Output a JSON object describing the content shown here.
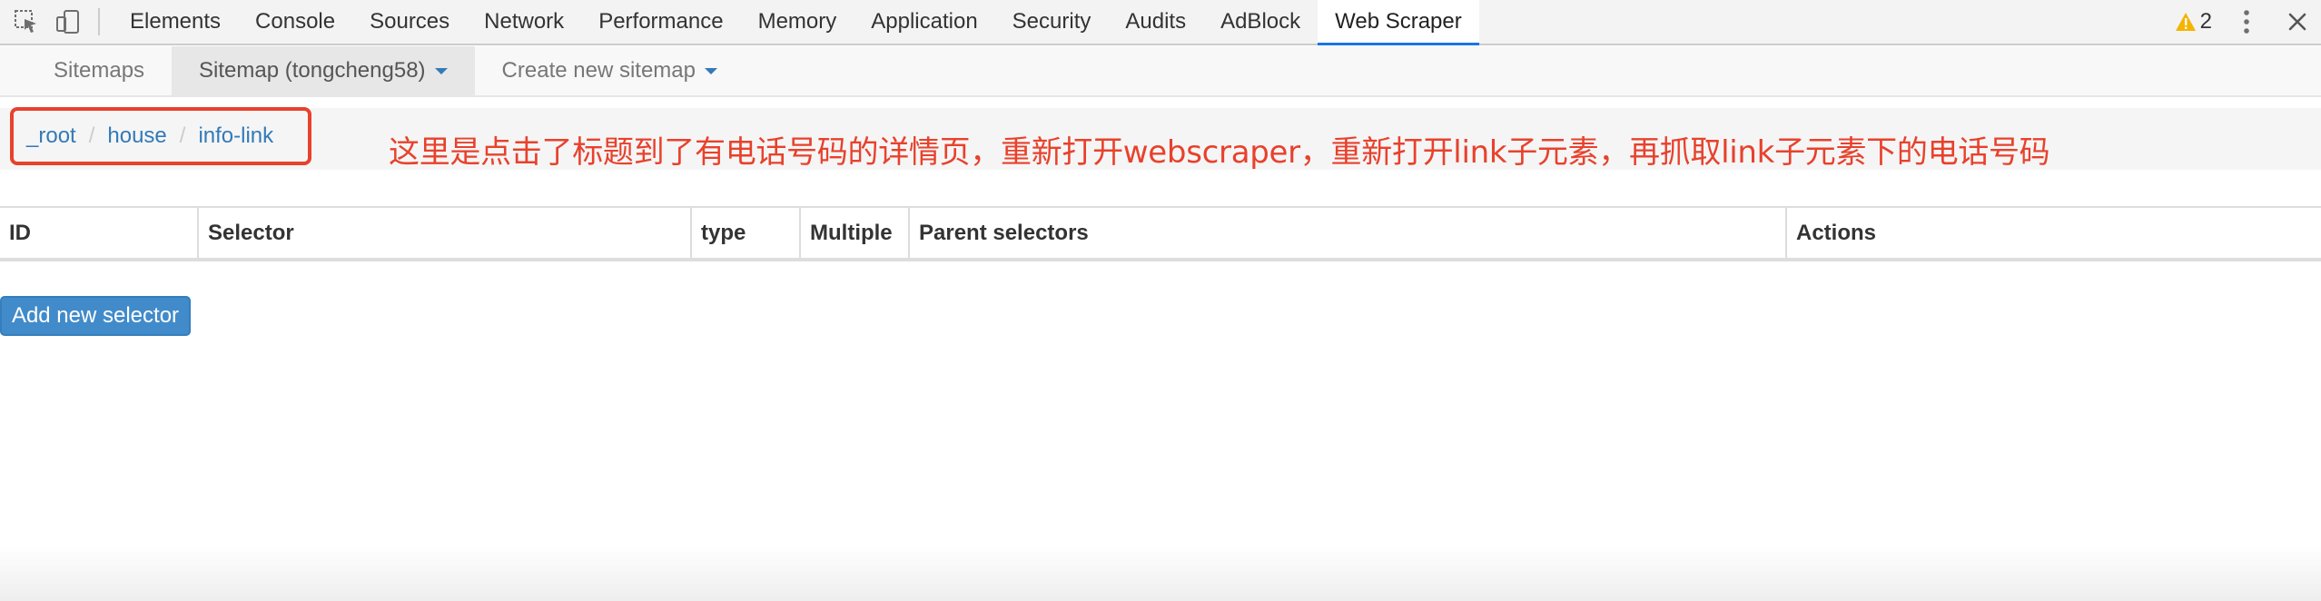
{
  "devtools": {
    "tabs": [
      {
        "label": "Elements"
      },
      {
        "label": "Console"
      },
      {
        "label": "Sources"
      },
      {
        "label": "Network"
      },
      {
        "label": "Performance"
      },
      {
        "label": "Memory"
      },
      {
        "label": "Application"
      },
      {
        "label": "Security"
      },
      {
        "label": "Audits"
      },
      {
        "label": "AdBlock"
      },
      {
        "label": "Web Scraper",
        "active": true
      }
    ],
    "warning_count": "2",
    "icons": {
      "inspect": "inspect-element-icon",
      "device": "device-toolbar-icon",
      "warning": "warning-triangle-icon",
      "menu": "kebab-menu-icon",
      "close": "close-icon"
    },
    "colors": {
      "active_tab_indicator": "#1a73e8",
      "warning": "#f4b400"
    }
  },
  "webscraper": {
    "nav": {
      "sitemaps": "Sitemaps",
      "sitemap": "Sitemap (tongcheng58)",
      "create": "Create new sitemap"
    },
    "breadcrumb": [
      "_root",
      "house",
      "info-link"
    ],
    "annotation": "这里是点击了标题到了有电话号码的详情页，重新打开webscraper，重新打开link子元素，再抓取link子元素下的电话号码",
    "table": {
      "headers": [
        "ID",
        "Selector",
        "type",
        "Multiple",
        "Parent selectors",
        "Actions"
      ]
    },
    "add_selector": "Add new selector",
    "colors": {
      "link": "#337ab7",
      "annotation": "#e8412c",
      "button": "#428bca"
    }
  }
}
